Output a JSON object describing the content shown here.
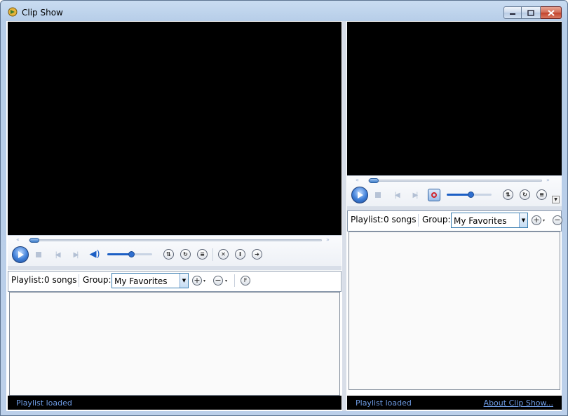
{
  "window": {
    "title": "Clip Show"
  },
  "left_panel": {
    "playlist": {
      "label": "Playlist:",
      "count": "0 songs",
      "group_label": "Group:",
      "group_value": "My Favorites"
    },
    "status": "Playlist loaded"
  },
  "right_panel": {
    "playlist": {
      "label": "Playlist:",
      "count": "0 songs",
      "group_label": "Group:",
      "group_value": "My Favorites"
    },
    "status": "Playlist loaded",
    "about_link": "About Clip Show..."
  },
  "icons": {
    "skip_back": "«",
    "skip_forward": "»",
    "prev": "|◀",
    "next": "▶|",
    "volume": "◀)",
    "shuffle": "⇅",
    "repeat": "↻",
    "list": "≡",
    "remove": "✕",
    "info": "I",
    "go": "➜",
    "add": "+",
    "minus": "−",
    "filter": "F",
    "dropdown": "▼",
    "caret": "▾"
  },
  "colors": {
    "status_text": "#6f9de6",
    "accent": "#1c5fc5",
    "combo_border": "#3c7fb1"
  },
  "volume_level": {
    "left": 0.55,
    "right": 0.55
  },
  "seek_position": {
    "left": 0.0,
    "right": 0.0
  }
}
